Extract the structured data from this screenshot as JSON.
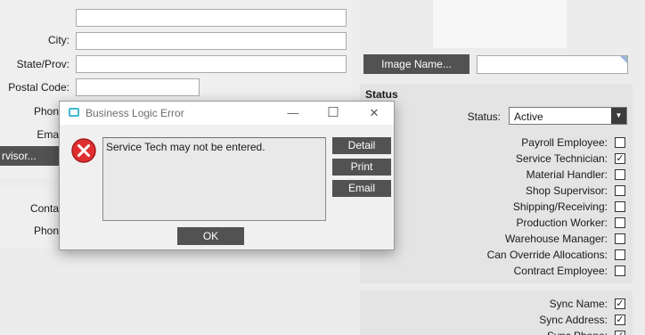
{
  "form": {
    "city_label": "City:",
    "state_label": "State/Prov:",
    "postal_label": "Postal Code:",
    "phone_label_partial": "Phon",
    "email_label_partial": "Ema",
    "supervisor_button_partial": "rvisor...",
    "contact_label_partial": "Conta",
    "phone2_label_partial": "Phon"
  },
  "image": {
    "button_label": "Image Name..."
  },
  "status_section": {
    "title": "Status",
    "status_label": "Status:",
    "status_value": "Active",
    "checks": [
      {
        "label": "Payroll Employee:",
        "checked": false
      },
      {
        "label": "Service Technician:",
        "checked": true
      },
      {
        "label": "Material Handler:",
        "checked": false
      },
      {
        "label": "Shop Supervisor:",
        "checked": false
      },
      {
        "label": "Shipping/Receiving:",
        "checked": false
      },
      {
        "label": "Production Worker:",
        "checked": false
      },
      {
        "label": "Warehouse Manager:",
        "checked": false
      },
      {
        "label": "Can Override Allocations:",
        "checked": false
      },
      {
        "label": "Contract Employee:",
        "checked": false
      }
    ]
  },
  "sync_section": {
    "checks": [
      {
        "label": "Sync Name:",
        "checked": true
      },
      {
        "label": "Sync Address:",
        "checked": true
      },
      {
        "label": "Sync Phone:",
        "checked": true
      }
    ]
  },
  "dialog": {
    "title": "Business Logic Error",
    "message": "Service Tech may not be entered.",
    "detail_label": "Detail",
    "print_label": "Print",
    "email_label": "Email",
    "ok_label": "OK",
    "minimize_glyph": "—",
    "maximize_glyph": "☐",
    "close_glyph": "✕"
  }
}
